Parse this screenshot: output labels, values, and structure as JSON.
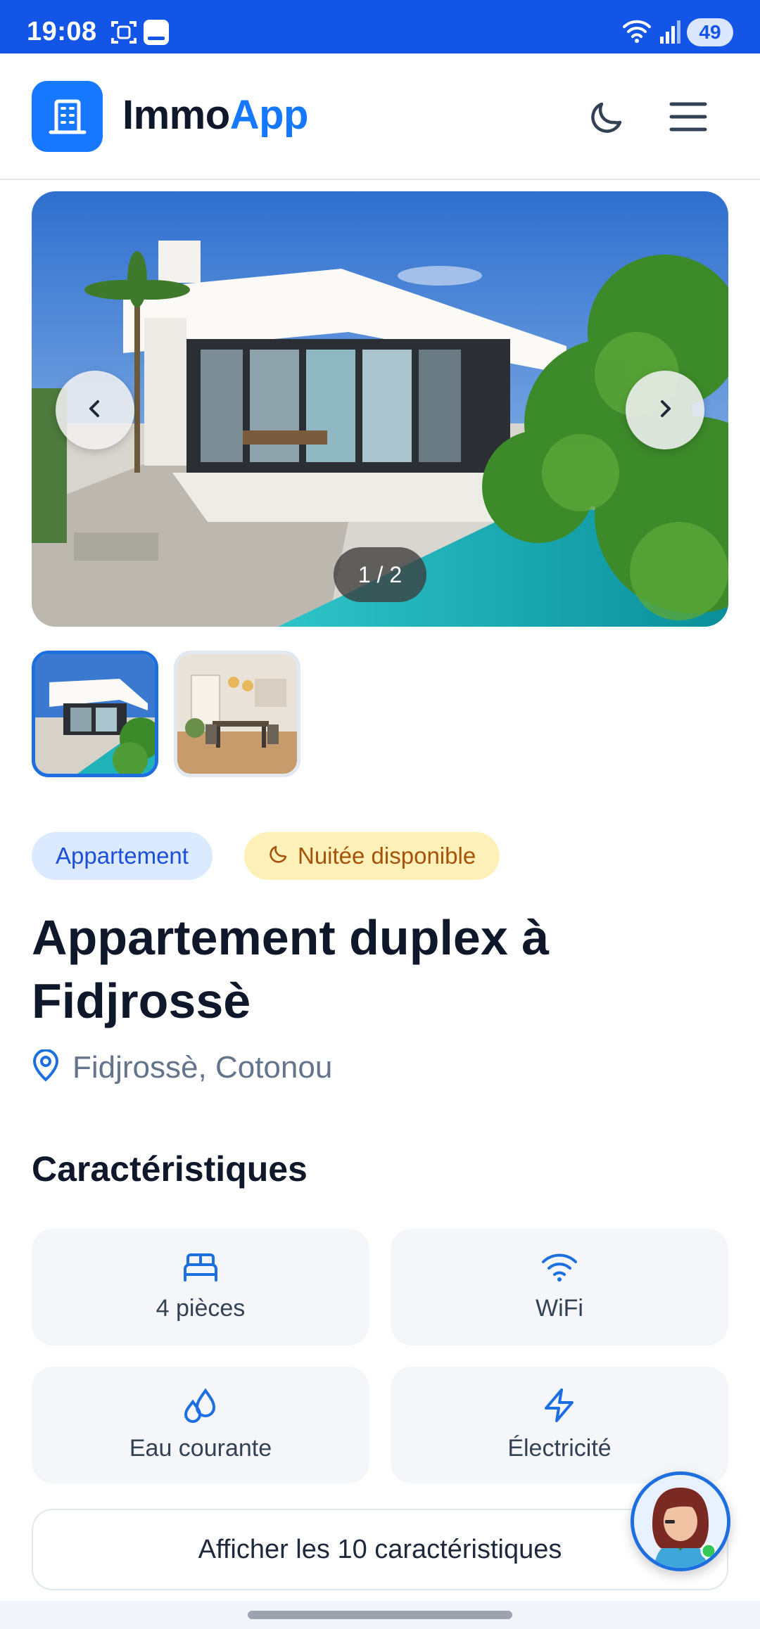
{
  "status_bar": {
    "time": "19:08",
    "battery": "49",
    "icons": [
      "screenshot-icon",
      "notification-icon",
      "wifi-icon",
      "signal-icon",
      "battery-icon"
    ]
  },
  "header": {
    "brand_part1": "Immo",
    "brand_part2": "App",
    "icons": [
      "building-logo-icon",
      "moon-icon",
      "menu-icon"
    ]
  },
  "gallery": {
    "counter": "1 / 2",
    "prev_icon": "chevron-left-icon",
    "next_icon": "chevron-right-icon",
    "thumbnails": [
      "villa-exterior",
      "dining-room"
    ],
    "active_index": 0
  },
  "listing": {
    "badge_type": "Appartement",
    "badge_availability": "Nuitée disponible",
    "title": "Appartement duplex à Fidjrossè",
    "location": "Fidjrossè, Cotonou"
  },
  "features": {
    "section_title": "Caractéristiques",
    "items": [
      {
        "label": "4 pièces",
        "icon": "bed-icon"
      },
      {
        "label": "WiFi",
        "icon": "wifi-icon"
      },
      {
        "label": "Eau courante",
        "icon": "water-drops-icon"
      },
      {
        "label": "Électricité",
        "icon": "lightning-icon"
      }
    ],
    "show_all": "Afficher les 10 caractéristiques"
  },
  "colors": {
    "status_bar": "#1355e6",
    "brand": "#1677ff",
    "badge_type_bg": "#dbeafe",
    "badge_night_bg": "#fdf0b8",
    "badge_night_text": "#a5520a"
  }
}
